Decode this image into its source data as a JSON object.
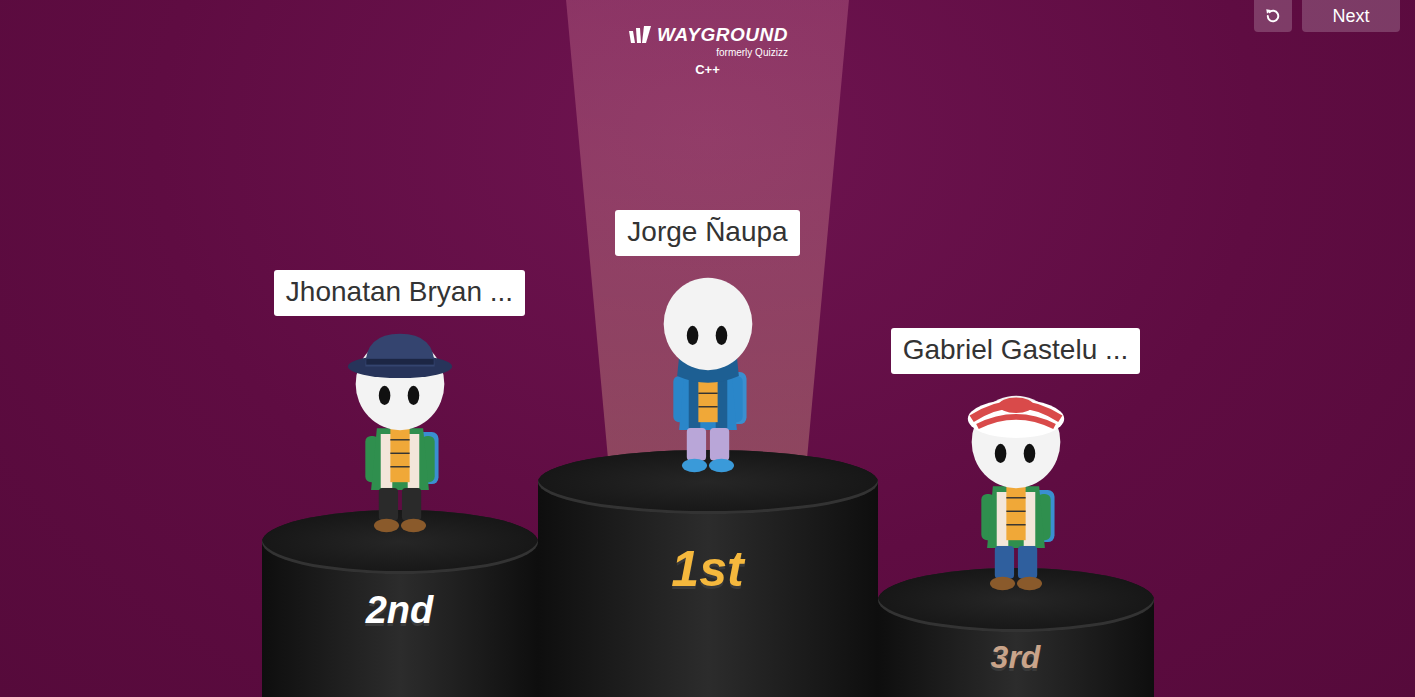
{
  "logo": {
    "brand": "WAYGROUND",
    "tagline": "formerly Quizizz"
  },
  "quiz": {
    "title": "C++"
  },
  "buttons": [
    "Next"
  ],
  "podium": [
    {
      "name": "Jhonatan Bryan ...",
      "place": "2nd",
      "kind": "fedora",
      "spotlight": false,
      "color": "#ffffff"
    },
    {
      "name": "Jorge Ñaupa",
      "place": "1st",
      "kind": "hooded",
      "spotlight": true,
      "color": "#f5b83d"
    },
    {
      "name": "Gabriel Gastelu ...",
      "place": "3rd",
      "kind": "cap",
      "spotlight": false,
      "color": "#c9a48a"
    }
  ]
}
